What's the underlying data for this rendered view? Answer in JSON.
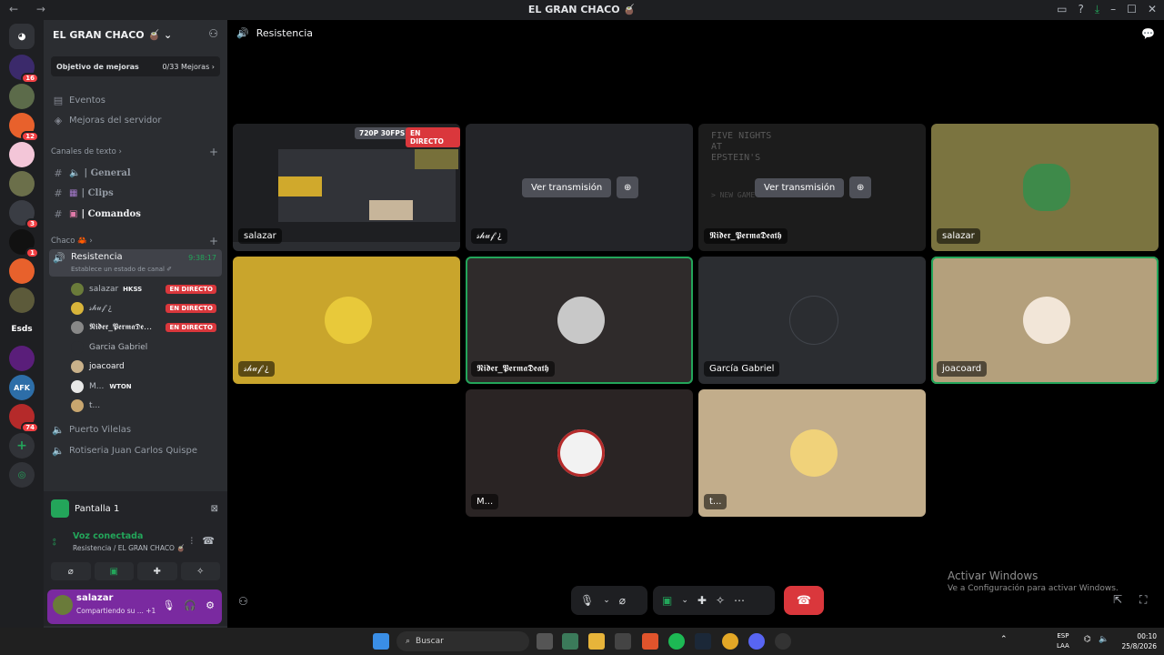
{
  "window": {
    "title": "EL GRAN CHACO 🧉",
    "nav": "← →"
  },
  "servers": {
    "badges": [
      "16",
      "12",
      "3",
      "1",
      "74"
    ],
    "esds_label": "Esds",
    "afk_label": "AFK"
  },
  "channel_sidebar": {
    "server_name": "EL GRAN CHACO 🧉 ⌄",
    "boost_goal": {
      "label": "Objetivo de mejoras",
      "value": "0/33 Mejoras ›"
    },
    "events": "Eventos",
    "server_boosts": "Mejoras del servidor",
    "text_category": "Canales de texto ›",
    "text_channels": [
      "| General",
      "| Clips",
      "| Comandos"
    ],
    "voice_category": "Chaco 🦀 ›",
    "active_voice": {
      "name": "Resistencia",
      "timer": "9:38:17",
      "status_hint": "Establece un estado de canal ✐"
    },
    "members": [
      {
        "name": "salazar",
        "extra": "HKSS",
        "live": "EN DIRECTO",
        "color": "#6a7b3a"
      },
      {
        "name": "𝓈𝒽𝓊𝒻 ¿",
        "extra": "",
        "live": "EN DIRECTO",
        "color": "#d8b43a"
      },
      {
        "name": "𝕹𝖎𝖉𝖊𝖗_𝕻𝖊𝖗𝖒𝖆𝕯𝖊…",
        "extra": "",
        "live": "EN DIRECTO",
        "color": "#888888"
      },
      {
        "name": "Garcia Gabriel",
        "extra": "",
        "live": "",
        "color": "#2b2d31"
      },
      {
        "name": "joacoard",
        "extra": "",
        "live": "",
        "color": "#c9b18a"
      },
      {
        "name": "M...",
        "extra": "WTON",
        "live": "",
        "color": "#e8e8e8"
      },
      {
        "name": "t...",
        "extra": "",
        "live": "",
        "color": "#c8a66f"
      }
    ],
    "other_voice": [
      "Puerto Vilelas",
      "Rotiseria Juan Carlos Quispe"
    ]
  },
  "user_panel": {
    "stream_source": "Pantalla 1",
    "voice_status": "Voz conectada",
    "voice_location": "Resistencia / EL GRAN CHACO 🧉",
    "username": "salazar",
    "user_status": "Compartiendo su ... +1"
  },
  "main": {
    "channel_title": "Resistencia",
    "tiles": [
      {
        "label": "salazar",
        "quality": "720P 30FPS",
        "live": "EN DIRECTO"
      },
      {
        "label": "𝓈𝒽𝓊𝒻 ¿",
        "watch": "Ver transmisión"
      },
      {
        "label": "𝕹𝖎𝖉𝖊𝖗_𝕻𝖊𝖗𝖒𝖆𝕯𝖊𝖆𝖙𝖍",
        "watch": "Ver transmisión",
        "bg_text": "FIVE NIGHTS AT EPSTEIN'S",
        "bg_sub": "> NEW GAME"
      },
      {
        "label": "salazar"
      },
      {
        "label": "𝓈𝒽𝓊𝒻 ¿"
      },
      {
        "label": "𝕹𝖎𝖉𝖊𝖗_𝕻𝖊𝖗𝖒𝖆𝕯𝖊𝖆𝖙𝖍"
      },
      {
        "label": "García Gabriel"
      },
      {
        "label": "joacoard"
      },
      {
        "label": "M..."
      },
      {
        "label": "t..."
      }
    ],
    "watermark_title": "Activar Windows",
    "watermark_sub": "Ve a Configuración para activar Windows."
  },
  "taskbar": {
    "search": "Buscar",
    "lang1": "ESP",
    "lang2": "LAA",
    "time": "00:10",
    "date": "25/8/2026"
  }
}
